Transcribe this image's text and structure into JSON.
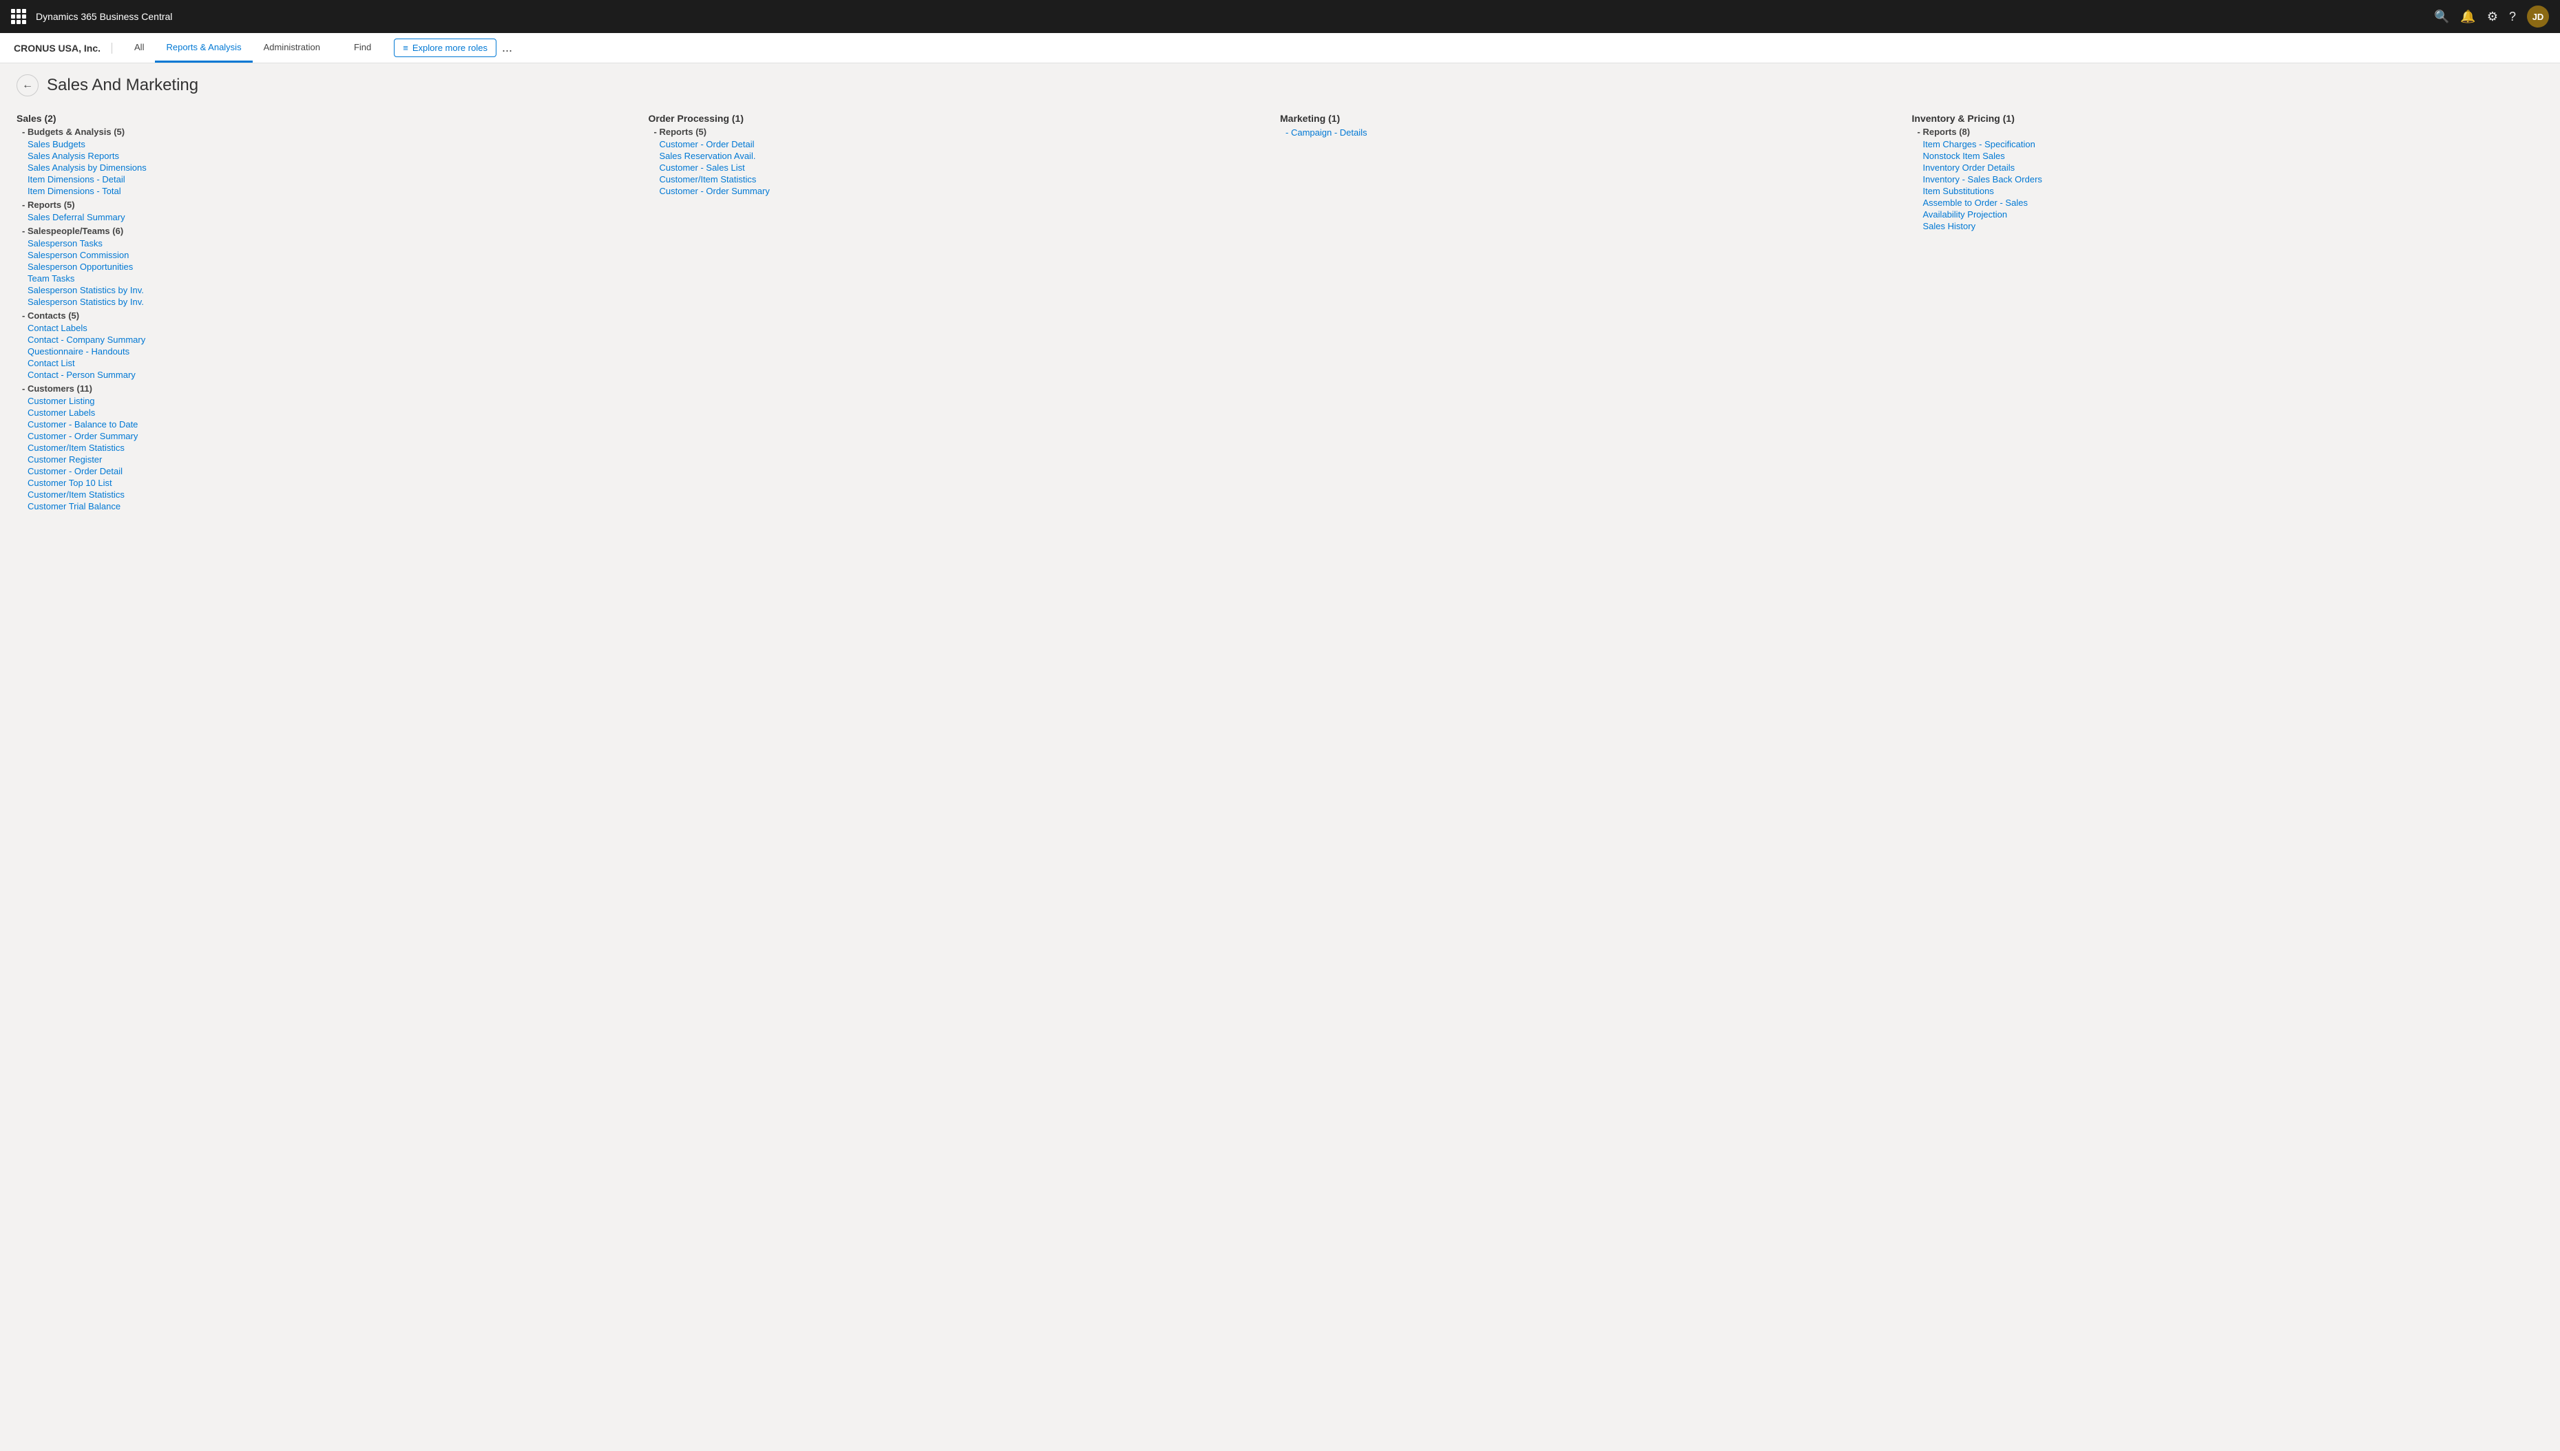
{
  "topBar": {
    "appTitle": "Dynamics 365 Business Central"
  },
  "secondBar": {
    "companyName": "CRONUS USA, Inc.",
    "tabs": [
      {
        "label": "All",
        "active": false
      },
      {
        "label": "Reports & Analysis",
        "active": true
      },
      {
        "label": "Administration",
        "active": false
      }
    ],
    "separator": true,
    "findTab": "Find",
    "exploreBtn": "Explore more roles",
    "moreBtn": "..."
  },
  "pageTitle": "Sales And Marketing",
  "backBtn": "←",
  "columns": {
    "sales": {
      "header": "Sales",
      "count": "(2)",
      "subsections": [
        {
          "label": "Budgets & Analysis",
          "count": "(5)",
          "items": [
            "Sales Budgets",
            "Sales Analysis Reports",
            "Sales Analysis by Dimensions",
            "Item Dimensions - Detail",
            "Item Dimensions - Total"
          ]
        },
        {
          "label": "Reports",
          "count": "(5)",
          "items": [
            "Sales Deferral Summary"
          ]
        },
        {
          "label": "Salespeople/Teams",
          "count": "(6)",
          "items": [
            "Salesperson Tasks",
            "Salesperson Commission",
            "Salesperson Opportunities",
            "Team Tasks",
            "Salesperson Statistics by Inv.",
            "Salesperson Statistics by Inv."
          ]
        },
        {
          "label": "Contacts",
          "count": "(5)",
          "items": [
            "Contact Labels",
            "Contact - Company Summary",
            "Questionnaire - Handouts",
            "Contact List",
            "Contact - Person Summary"
          ]
        },
        {
          "label": "Customers",
          "count": "(11)",
          "items": [
            "Customer Listing",
            "Customer Labels",
            "Customer - Balance to Date",
            "Customer - Order Summary",
            "Customer/Item Statistics",
            "Customer Register",
            "Customer - Order Detail",
            "Customer Top 10 List",
            "Customer/Item Statistics",
            "Customer Trial Balance"
          ]
        }
      ]
    },
    "orderProcessing": {
      "header": "Order Processing",
      "count": "(1)",
      "subsections": [
        {
          "label": "Reports",
          "count": "(5)",
          "items": [
            "Customer - Order Detail",
            "Sales Reservation Avail.",
            "Customer - Sales List",
            "Customer/Item Statistics",
            "Customer - Order Summary"
          ]
        }
      ]
    },
    "marketing": {
      "header": "Marketing",
      "count": "(1)",
      "subsections": [
        {
          "label": "",
          "count": "",
          "items": [
            "Campaign - Details"
          ]
        }
      ]
    },
    "inventoryPricing": {
      "header": "Inventory & Pricing",
      "count": "(1)",
      "subsections": [
        {
          "label": "Reports",
          "count": "(8)",
          "items": [
            "Item Charges - Specification",
            "Nonstock Item Sales",
            "Inventory Order Details",
            "Inventory - Sales Back Orders",
            "Item Substitutions",
            "Assemble to Order - Sales",
            "Availability Projection",
            "Sales History"
          ]
        }
      ]
    }
  }
}
